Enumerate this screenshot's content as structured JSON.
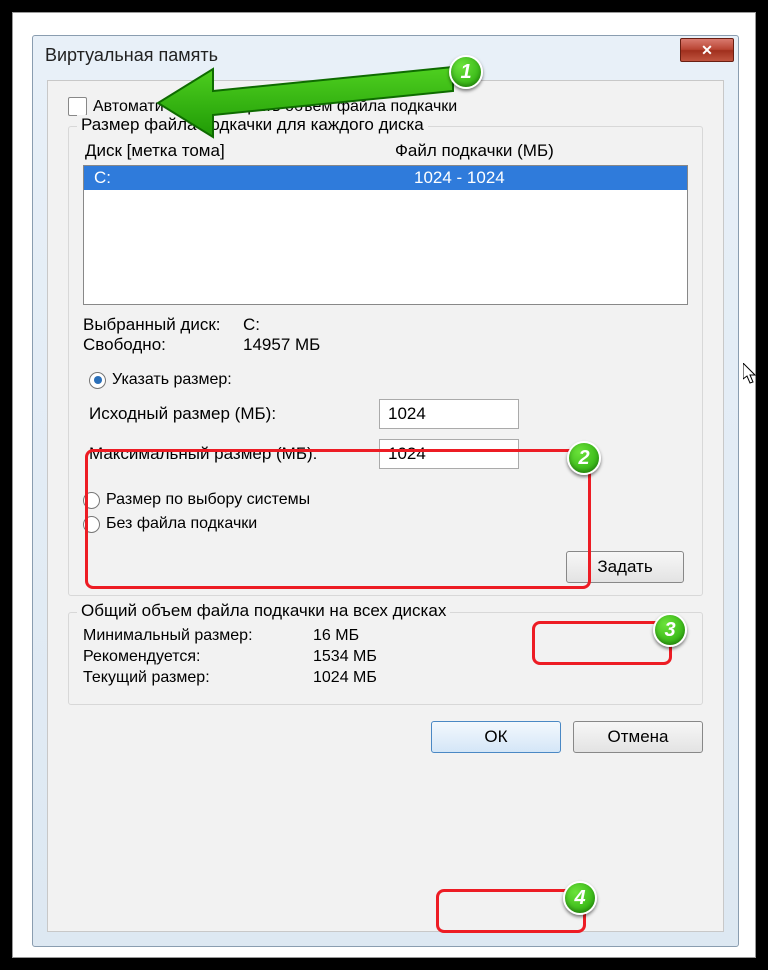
{
  "window": {
    "title": "Виртуальная память"
  },
  "auto_checkbox": {
    "label": "Автоматически выбирать объем файла подкачки"
  },
  "pagefile_group": {
    "legend": "Размер файла подкачки для каждого диска",
    "header_drive": "Диск [метка тома]",
    "header_size": "Файл подкачки (МБ)",
    "drives": [
      {
        "name": "C:",
        "size": "1024 - 1024"
      }
    ],
    "selected_drive_label": "Выбранный диск:",
    "selected_drive_value": "C:",
    "free_label": "Свободно:",
    "free_value": "14957 МБ",
    "custom_size_label": "Указать размер:",
    "initial_label": "Исходный размер (МБ):",
    "initial_value": "1024",
    "max_label": "Максимальный размер (МБ):",
    "max_value": "1024",
    "system_managed_label": "Размер по выбору системы",
    "no_pagefile_label": "Без файла подкачки",
    "set_button": "Задать"
  },
  "totals_group": {
    "legend": "Общий объем файла подкачки на всех дисках",
    "min_label": "Минимальный размер:",
    "min_value": "16 МБ",
    "rec_label": "Рекомендуется:",
    "rec_value": "1534 МБ",
    "cur_label": "Текущий размер:",
    "cur_value": "1024 МБ"
  },
  "buttons": {
    "ok": "ОК",
    "cancel": "Отмена"
  },
  "markers": {
    "m1": "1",
    "m2": "2",
    "m3": "3",
    "m4": "4"
  }
}
